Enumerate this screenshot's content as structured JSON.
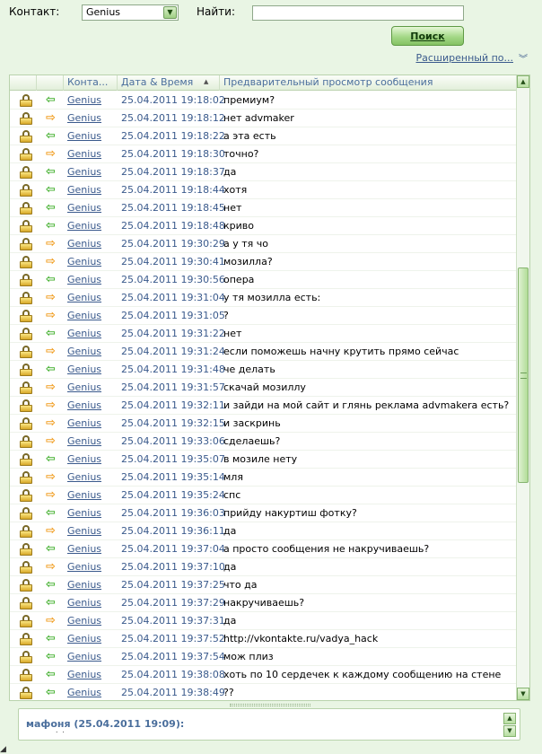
{
  "filters": {
    "contact_label": "Контакт:",
    "contact_value": "Genius",
    "search_label": "Найти:",
    "search_value": "",
    "search_button": "Поиск",
    "advanced_link": "Расширенный по..."
  },
  "table": {
    "columns": [
      "Конта...",
      "Дата & Время",
      "Предварительный просмотр сообщения"
    ],
    "rows": [
      {
        "contact": "Genius",
        "datetime": "25.04.2011 19:18:02",
        "message": "премиум?",
        "direction": "in"
      },
      {
        "contact": "Genius",
        "datetime": "25.04.2011 19:18:12",
        "message": "нет advmaker",
        "direction": "out"
      },
      {
        "contact": "Genius",
        "datetime": "25.04.2011 19:18:22",
        "message": "а эта есть",
        "direction": "in"
      },
      {
        "contact": "Genius",
        "datetime": "25.04.2011 19:18:30",
        "message": "точно?",
        "direction": "out"
      },
      {
        "contact": "Genius",
        "datetime": "25.04.2011 19:18:37",
        "message": "да",
        "direction": "in"
      },
      {
        "contact": "Genius",
        "datetime": "25.04.2011 19:18:44",
        "message": "хотя",
        "direction": "in"
      },
      {
        "contact": "Genius",
        "datetime": "25.04.2011 19:18:45",
        "message": "нет",
        "direction": "in"
      },
      {
        "contact": "Genius",
        "datetime": "25.04.2011 19:18:48",
        "message": "криво",
        "direction": "in"
      },
      {
        "contact": "Genius",
        "datetime": "25.04.2011 19:30:29",
        "message": "а у тя чо",
        "direction": "out"
      },
      {
        "contact": "Genius",
        "datetime": "25.04.2011 19:30:41",
        "message": "мозилла?",
        "direction": "out"
      },
      {
        "contact": "Genius",
        "datetime": "25.04.2011 19:30:56",
        "message": "опера",
        "direction": "in"
      },
      {
        "contact": "Genius",
        "datetime": "25.04.2011 19:31:04",
        "message": "у тя мозилла есть:",
        "direction": "out"
      },
      {
        "contact": "Genius",
        "datetime": "25.04.2011 19:31:05",
        "message": "?",
        "direction": "out"
      },
      {
        "contact": "Genius",
        "datetime": "25.04.2011 19:31:22",
        "message": "нет",
        "direction": "in"
      },
      {
        "contact": "Genius",
        "datetime": "25.04.2011 19:31:24",
        "message": "если поможешь начну крутить прямо сейчас",
        "direction": "out"
      },
      {
        "contact": "Genius",
        "datetime": "25.04.2011 19:31:48",
        "message": "че делать",
        "direction": "in"
      },
      {
        "contact": "Genius",
        "datetime": "25.04.2011 19:31:57",
        "message": "скачай мозиллу",
        "direction": "out"
      },
      {
        "contact": "Genius",
        "datetime": "25.04.2011 19:32:11",
        "message": "и зайди на мой сайт и глянь реклама advmakera есть?",
        "direction": "out"
      },
      {
        "contact": "Genius",
        "datetime": "25.04.2011 19:32:15",
        "message": "и заскринь",
        "direction": "out"
      },
      {
        "contact": "Genius",
        "datetime": "25.04.2011 19:33:06",
        "message": "сделаешь?",
        "direction": "out"
      },
      {
        "contact": "Genius",
        "datetime": "25.04.2011 19:35:07",
        "message": "в мозиле нету",
        "direction": "in"
      },
      {
        "contact": "Genius",
        "datetime": "25.04.2011 19:35:14",
        "message": "мля",
        "direction": "out"
      },
      {
        "contact": "Genius",
        "datetime": "25.04.2011 19:35:24",
        "message": "спс",
        "direction": "out"
      },
      {
        "contact": "Genius",
        "datetime": "25.04.2011 19:36:03",
        "message": "прийду накуртиш фотку?",
        "direction": "in"
      },
      {
        "contact": "Genius",
        "datetime": "25.04.2011 19:36:11",
        "message": "да",
        "direction": "out"
      },
      {
        "contact": "Genius",
        "datetime": "25.04.2011 19:37:04",
        "message": "а просто сообщения не накручиваешь?",
        "direction": "in"
      },
      {
        "contact": "Genius",
        "datetime": "25.04.2011 19:37:10",
        "message": "да",
        "direction": "out"
      },
      {
        "contact": "Genius",
        "datetime": "25.04.2011 19:37:25",
        "message": "что да",
        "direction": "in"
      },
      {
        "contact": "Genius",
        "datetime": "25.04.2011 19:37:29",
        "message": "накручиваешь?",
        "direction": "in"
      },
      {
        "contact": "Genius",
        "datetime": "25.04.2011 19:37:31",
        "message": "да",
        "direction": "out"
      },
      {
        "contact": "Genius",
        "datetime": "25.04.2011 19:37:52",
        "message": "http://vkontakte.ru/vadya_hack",
        "direction": "in"
      },
      {
        "contact": "Genius",
        "datetime": "25.04.2011 19:37:54",
        "message": "мож плиз",
        "direction": "in"
      },
      {
        "contact": "Genius",
        "datetime": "25.04.2011 19:38:08",
        "message": "хоть по 10 сердечек к каждому сообщению на стене",
        "direction": "in"
      },
      {
        "contact": "Genius",
        "datetime": "25.04.2011 19:38:49",
        "message": "??",
        "direction": "in"
      }
    ]
  },
  "preview": {
    "title": "мафоня (25.04.2011 19:09):"
  },
  "colors": {
    "incoming_arrow": "#3fae2a",
    "outgoing_arrow": "#f09a1a",
    "link": "#3a5a8c"
  }
}
